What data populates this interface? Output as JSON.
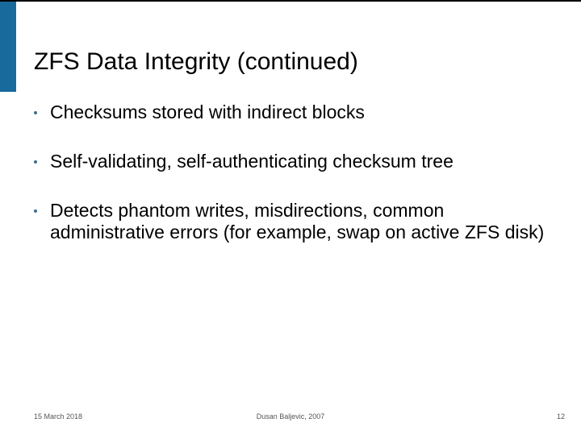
{
  "title": "ZFS Data Integrity (continued)",
  "bullets": [
    "Checksums stored with indirect blocks",
    "Self-validating, self-authenticating checksum tree",
    "Detects phantom writes, misdirections, common administrative errors (for example, swap on active ZFS disk)"
  ],
  "footer": {
    "date": "15 March 2018",
    "author": "Dusan Baljevic, 2007",
    "page": "12"
  }
}
